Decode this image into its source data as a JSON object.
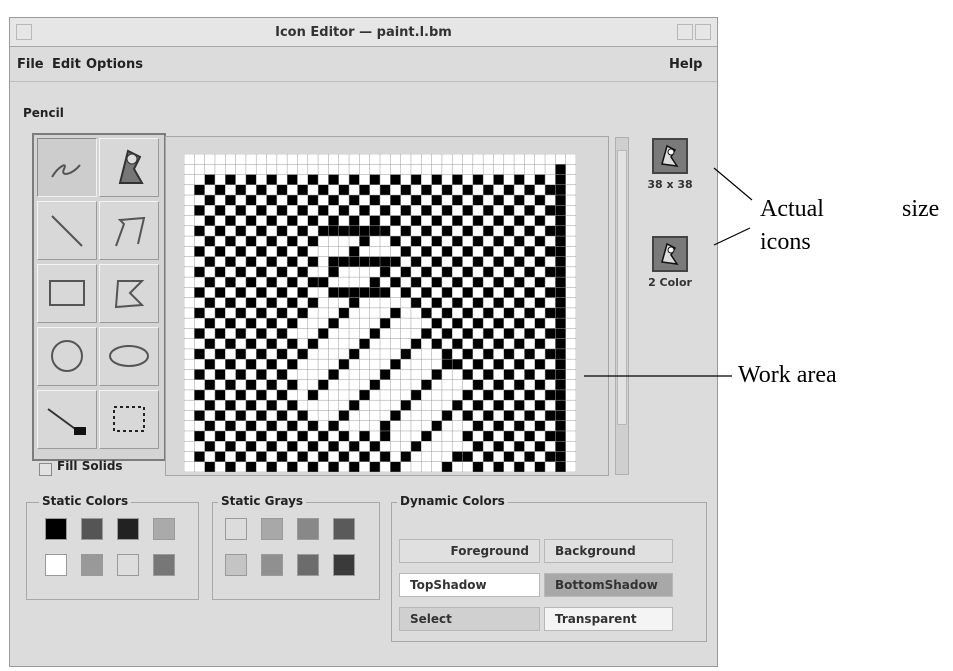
{
  "window": {
    "title": "Icon Editor — paint.l.bm"
  },
  "menu": {
    "file": "File",
    "edit": "Edit",
    "options": "Options",
    "help": "Help"
  },
  "tools": {
    "current_tool": "Pencil",
    "items": [
      "pencil",
      "flood-fill",
      "line",
      "polyline",
      "rectangle",
      "polygon",
      "circle",
      "ellipse",
      "eraser",
      "select-region"
    ],
    "selected": "pencil",
    "fill_solids_label": "Fill Solids",
    "fill_solids_checked": false
  },
  "preview": {
    "size_label": "38 x 38",
    "color_label": "2 Color"
  },
  "static_colors": {
    "title": "Static Colors",
    "swatches": [
      "#000000",
      "#555555",
      "#222222",
      "#aaaaaa",
      "#ffffff",
      "#999999",
      "#dddddd",
      "#777777"
    ]
  },
  "static_grays": {
    "title": "Static Grays",
    "swatches": [
      "#dcdcdc",
      "#a8a8a8",
      "#888888",
      "#5a5a5a",
      "#c4c4c4",
      "#909090",
      "#6c6c6c",
      "#3a3a3a"
    ]
  },
  "dynamic_colors": {
    "title": "Dynamic Colors",
    "foreground": "Foreground",
    "background": "Background",
    "top_shadow": "TopShadow",
    "bottom_shadow": "BottomShadow",
    "select": "Select",
    "transparent": "Transparent"
  },
  "annotations": {
    "actual_size_1": "Actual",
    "actual_size_2": "size",
    "icons": "icons",
    "work_area": "Work area"
  },
  "colors": {
    "window_bg": "#dcdcdc",
    "grid_black": "#000000",
    "grid_white": "#ffffff"
  }
}
